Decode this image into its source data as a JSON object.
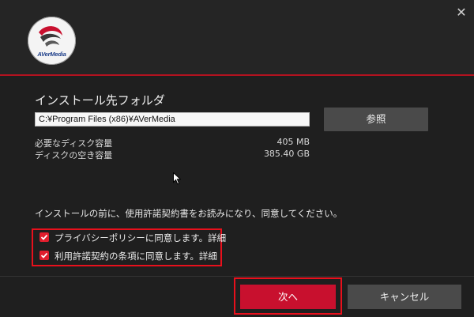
{
  "header": {
    "logo_text": "AVerMedia",
    "accent_color": "#c8102e"
  },
  "install": {
    "title": "インストール先フォルダ",
    "path_value": "C:¥Program Files (x86)¥AVerMedia",
    "browse_label": "参照",
    "required_label": "必要なディスク容量",
    "required_value": "405 MB",
    "free_label": "ディスクの空き容量",
    "free_value": "385.40 GB"
  },
  "agreement": {
    "notice": "インストールの前に、使用許諾契約書をお読みになり、同意してください。",
    "items": [
      {
        "label": "プライバシーポリシーに同意します。",
        "link": "詳細",
        "checked": true
      },
      {
        "label": "利用許諾契約の条項に同意します。",
        "link": "詳細",
        "checked": true
      }
    ]
  },
  "footer": {
    "next_label": "次へ",
    "cancel_label": "キャンセル"
  }
}
